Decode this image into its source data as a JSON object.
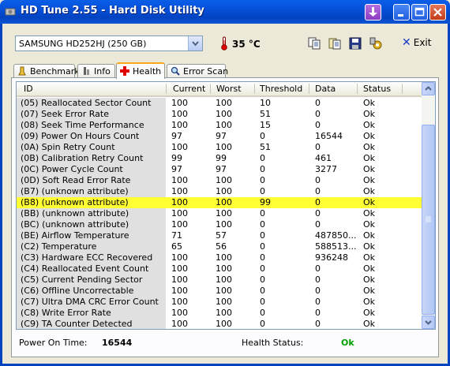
{
  "window": {
    "title": "HD Tune 2.55 - Hard Disk Utility"
  },
  "toolbar": {
    "drive": "SAMSUNG HD252HJ (250 GB)",
    "temperature": "35 °C",
    "exit_label": "Exit"
  },
  "tabs": [
    "Benchmark",
    "Info",
    "Health",
    "Error Scan"
  ],
  "columns": [
    "ID",
    "Current",
    "Worst",
    "Threshold",
    "Data",
    "Status"
  ],
  "rows": [
    [
      "(05) Reallocated Sector Count",
      "100",
      "100",
      "10",
      "0",
      "Ok"
    ],
    [
      "(07) Seek Error Rate",
      "100",
      "100",
      "51",
      "0",
      "Ok"
    ],
    [
      "(08) Seek Time Performance",
      "100",
      "100",
      "15",
      "0",
      "Ok"
    ],
    [
      "(09) Power On Hours Count",
      "97",
      "97",
      "0",
      "16544",
      "Ok"
    ],
    [
      "(0A) Spin Retry Count",
      "100",
      "100",
      "51",
      "0",
      "Ok"
    ],
    [
      "(0B) Calibration Retry Count",
      "99",
      "99",
      "0",
      "461",
      "Ok"
    ],
    [
      "(0C) Power Cycle Count",
      "97",
      "97",
      "0",
      "3277",
      "Ok"
    ],
    [
      "(0D) Soft Read Error Rate",
      "100",
      "100",
      "0",
      "0",
      "Ok"
    ],
    [
      "(B7) (unknown attribute)",
      "100",
      "100",
      "0",
      "0",
      "Ok"
    ],
    [
      "(B8) (unknown attribute)",
      "100",
      "100",
      "99",
      "0",
      "Ok"
    ],
    [
      "(BB) (unknown attribute)",
      "100",
      "100",
      "0",
      "0",
      "Ok"
    ],
    [
      "(BC) (unknown attribute)",
      "100",
      "100",
      "0",
      "0",
      "Ok"
    ],
    [
      "(BE) Airflow Temperature",
      "71",
      "57",
      "0",
      "487850...",
      "Ok"
    ],
    [
      "(C2) Temperature",
      "65",
      "56",
      "0",
      "588513...",
      "Ok"
    ],
    [
      "(C3) Hardware ECC Recovered",
      "100",
      "100",
      "0",
      "936248",
      "Ok"
    ],
    [
      "(C4) Reallocated Event Count",
      "100",
      "100",
      "0",
      "0",
      "Ok"
    ],
    [
      "(C5) Current Pending Sector",
      "100",
      "100",
      "0",
      "0",
      "Ok"
    ],
    [
      "(C6) Offline Uncorrectable",
      "100",
      "100",
      "0",
      "0",
      "Ok"
    ],
    [
      "(C7) Ultra DMA CRC Error Count",
      "100",
      "100",
      "0",
      "0",
      "Ok"
    ],
    [
      "(C8) Write Error Rate",
      "100",
      "100",
      "0",
      "0",
      "Ok"
    ],
    [
      "(C9) TA Counter Detected",
      "100",
      "100",
      "0",
      "0",
      "Ok"
    ]
  ],
  "footer": {
    "power_on_label": "Power On Time:",
    "power_on_value": "16544",
    "health_label": "Health Status:",
    "health_value": "Ok"
  },
  "colors": {
    "highlight": "#FFFF33",
    "health_ok": "#00A000"
  }
}
